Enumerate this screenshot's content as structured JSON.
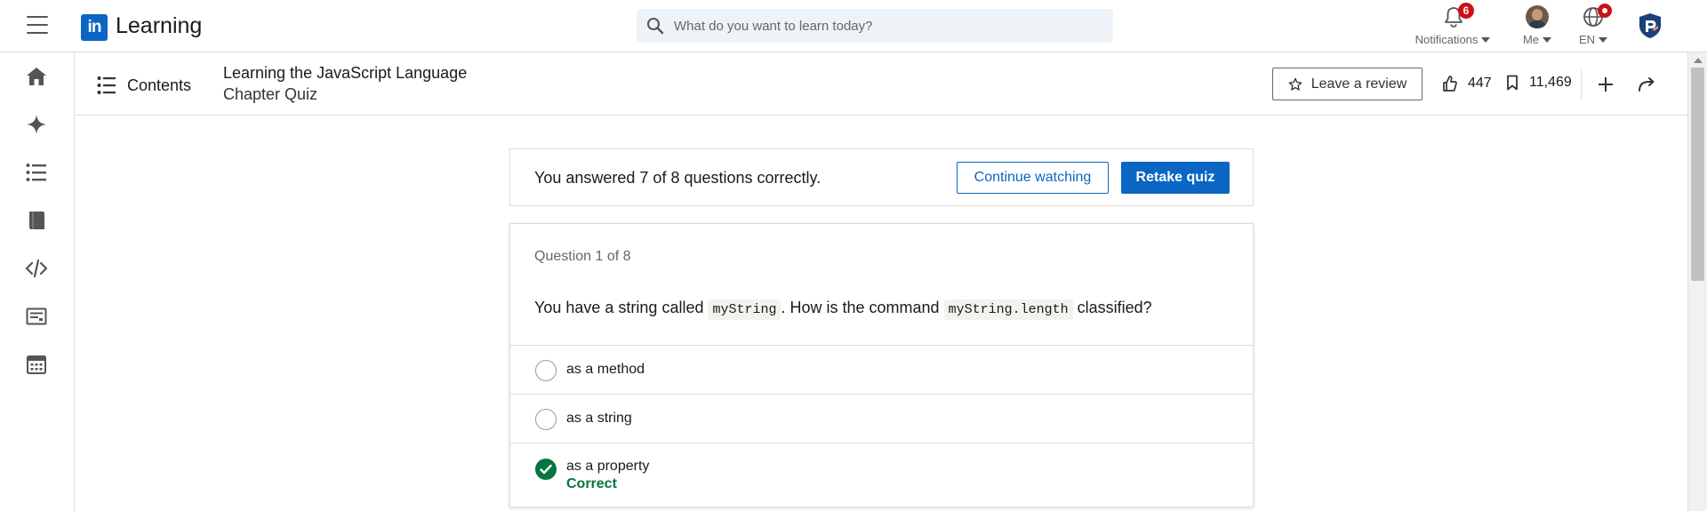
{
  "topnav": {
    "brand_logo": "in",
    "brand_name": "Learning",
    "search_placeholder": "What do you want to learn today?",
    "notifications": {
      "label": "Notifications",
      "count": "6"
    },
    "me": {
      "label": "Me"
    },
    "language": {
      "label": "EN"
    }
  },
  "sidebar": {
    "items": [
      {
        "icon": "home-icon"
      },
      {
        "icon": "sparkle-icon"
      },
      {
        "icon": "list-icon"
      },
      {
        "icon": "book-icon"
      },
      {
        "icon": "code-icon"
      },
      {
        "icon": "certificate-icon"
      },
      {
        "icon": "calendar-icon"
      }
    ]
  },
  "course_header": {
    "contents_label": "Contents",
    "course_title": "Learning the JavaScript Language",
    "section_title": "Chapter Quiz",
    "review_label": "Leave a review",
    "likes": "447",
    "saves": "11,469"
  },
  "quiz": {
    "result_text": "You answered 7 of 8 questions correctly.",
    "continue_label": "Continue watching",
    "retake_label": "Retake quiz",
    "question_counter": "Question 1 of 8",
    "question": {
      "part1": "You have a string called ",
      "code1": "myString",
      "part2": ". How is the command ",
      "code2": "myString.length",
      "part3": " classified?"
    },
    "options": [
      {
        "label": "as a method",
        "state": "unselected"
      },
      {
        "label": "as a string",
        "state": "unselected"
      },
      {
        "label": "as a property",
        "state": "correct",
        "feedback": "Correct"
      }
    ]
  },
  "colors": {
    "brand_blue": "#0a66c2",
    "correct_green": "#057642",
    "badge_red": "#cc1016"
  }
}
